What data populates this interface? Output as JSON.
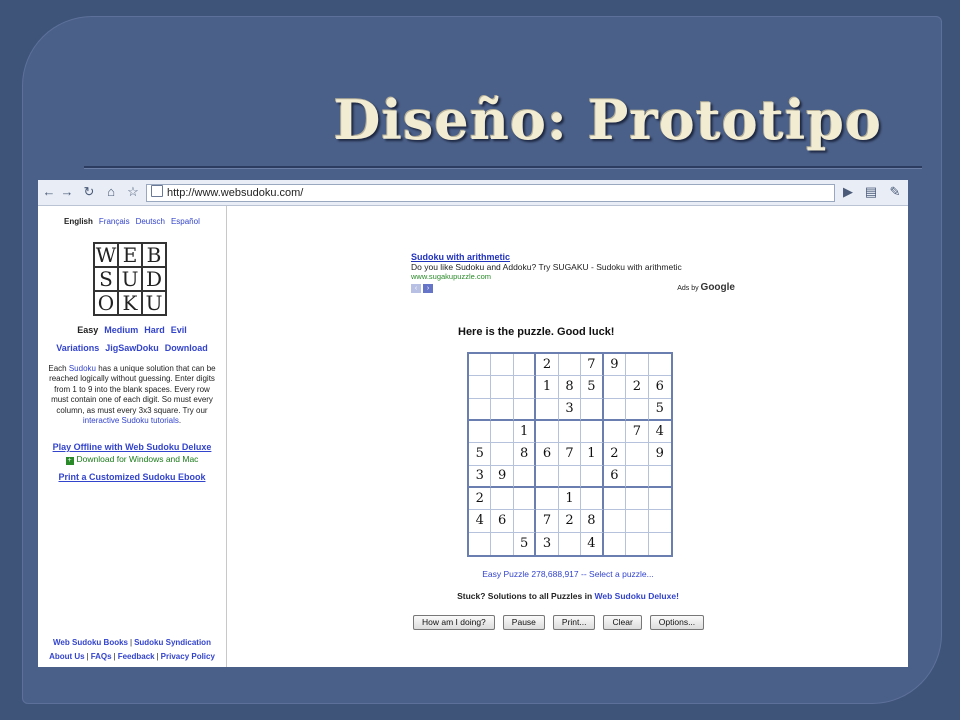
{
  "slide": {
    "title": "Diseño: Prototipo"
  },
  "browser": {
    "url": "http://www.websudoku.com/",
    "icons": [
      "back-icon",
      "forward-icon",
      "reload-icon",
      "home-icon",
      "page-icon",
      "play-icon",
      "page-menu-icon",
      "wrench-icon"
    ]
  },
  "sidebar": {
    "languages": [
      "English",
      "Français",
      "Deutsch",
      "Español"
    ],
    "logo_letters": [
      "W",
      "E",
      "B",
      "S",
      "U",
      "D",
      "O",
      "K",
      "U"
    ],
    "levels": [
      "Easy",
      "Medium",
      "Hard",
      "Evil"
    ],
    "links": [
      "Variations",
      "JigSawDoku",
      "Download"
    ],
    "desc_1": "Each ",
    "desc_link1": "Sudoku",
    "desc_2": " has a unique solution that can be reached logically without guessing. Enter digits from 1 to 9 into the blank spaces. Every row must contain one of each digit. So must every column, as must every 3x3 square. Try our ",
    "desc_link2": "interactive Sudoku tutorials",
    "desc_3": ".",
    "offline": "Play Offline with Web Sudoku Deluxe",
    "download": "Download for Windows and Mac",
    "ebook": "Print a Customized Sudoku Ebook",
    "footer1": [
      "Web Sudoku Books",
      "Sudoku Syndication"
    ],
    "footer2": [
      "About Us",
      "FAQs",
      "Feedback",
      "Privacy Policy"
    ],
    "separator": "|"
  },
  "ad": {
    "title": "Sudoku with arithmetic",
    "text": "Do you like Sudoku and Addoku? Try SUGAKU - Sudoku with arithmetic",
    "url": "www.sugakupuzzle.com",
    "ads_by": "Ads by",
    "google": "Google",
    "prev": "‹",
    "next": "›"
  },
  "puzzle": {
    "heading": "Here is the puzzle. Good luck!",
    "grid": [
      [
        "",
        "",
        "",
        "2",
        "",
        "7",
        "9",
        "",
        ""
      ],
      [
        "",
        "",
        "",
        "1",
        "8",
        "5",
        "",
        "2",
        "6"
      ],
      [
        "",
        "",
        "",
        "",
        "3",
        "",
        "",
        "",
        "5"
      ],
      [
        "",
        "",
        "1",
        "",
        "",
        "",
        "",
        "7",
        "4"
      ],
      [
        "5",
        "",
        "8",
        "6",
        "7",
        "1",
        "2",
        "",
        "9"
      ],
      [
        "3",
        "9",
        "",
        "",
        "",
        "",
        "6",
        "",
        ""
      ],
      [
        "2",
        "",
        "",
        "",
        "1",
        "",
        "",
        "",
        ""
      ],
      [
        "4",
        "6",
        "",
        "7",
        "2",
        "8",
        "",
        "",
        ""
      ],
      [
        "",
        "",
        "5",
        "3",
        "",
        "4",
        "",
        "",
        ""
      ]
    ],
    "caption": "Easy Puzzle 278,688,917 -- Select a puzzle...",
    "stuck_text": "Stuck? Solutions to all Puzzles in ",
    "stuck_link": "Web Sudoku Deluxe!",
    "buttons": [
      "How am I doing?",
      "Pause",
      "Print...",
      "Clear",
      "Options..."
    ]
  }
}
